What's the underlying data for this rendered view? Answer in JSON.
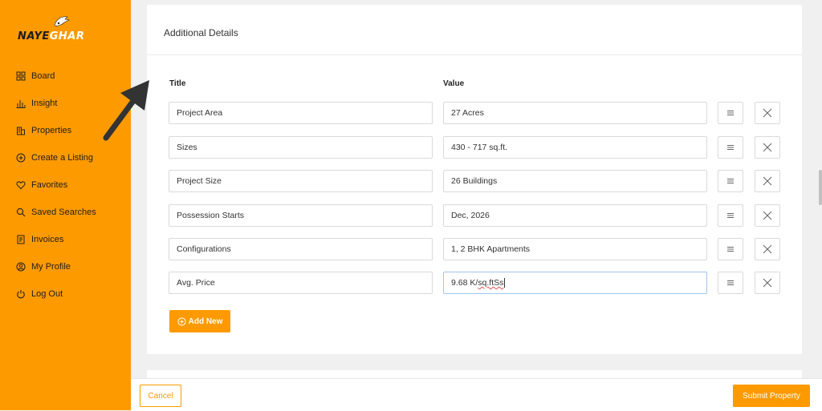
{
  "brand": {
    "name_part1": "NAYE",
    "name_part2": "GHAR"
  },
  "sidebar": {
    "items": [
      {
        "label": "Board",
        "icon": "board-icon"
      },
      {
        "label": "Insight",
        "icon": "bar-chart-icon"
      },
      {
        "label": "Properties",
        "icon": "building-icon"
      },
      {
        "label": "Create a Listing",
        "icon": "plus-circle-icon"
      },
      {
        "label": "Favorites",
        "icon": "heart-icon"
      },
      {
        "label": "Saved Searches",
        "icon": "search-icon"
      },
      {
        "label": "Invoices",
        "icon": "invoice-icon"
      },
      {
        "label": "My Profile",
        "icon": "profile-icon"
      },
      {
        "label": "Log Out",
        "icon": "power-icon"
      }
    ]
  },
  "details": {
    "title": "Additional Details",
    "col_title": "Title",
    "col_value": "Value",
    "rows": [
      {
        "title": "Project Area",
        "value": "27 Acres"
      },
      {
        "title": "Sizes",
        "value": "430 - 717 sq.ft."
      },
      {
        "title": "Project Size",
        "value": "26 Buildings"
      },
      {
        "title": "Possession Starts",
        "value": "Dec, 2026"
      },
      {
        "title": "Configurations",
        "value": "1, 2 BHK Apartments"
      },
      {
        "title": "Avg. Price",
        "value_prefix": "9.68 K/",
        "value_misspelled": "sq.ftSs"
      }
    ],
    "add_label": "Add New"
  },
  "footer": {
    "cancel_label": "Cancel",
    "submit_label": "Submit Property"
  },
  "colors": {
    "accent": "#fd9a00",
    "sidebar_text": "#1f1f1f",
    "focus_border": "#9ec6ea"
  }
}
